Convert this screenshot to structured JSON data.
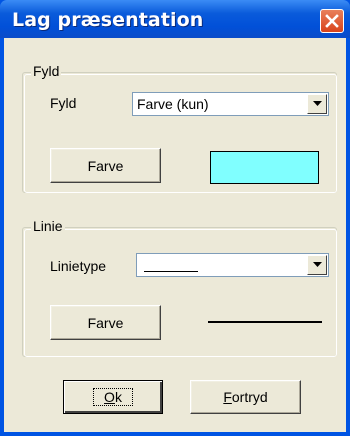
{
  "window": {
    "title": "Lag præsentation"
  },
  "icons": {
    "close": "close-x-icon",
    "dropdown": "chevron-down-icon"
  },
  "colors": {
    "fill_swatch": "#80ffff",
    "titlebar": "#0054e3",
    "close_button": "#d9431b"
  },
  "fill_group": {
    "legend": "Fyld",
    "fill_label": "Fyld",
    "fill_select": {
      "value": "Farve (kun)"
    },
    "color_button": "Farve"
  },
  "line_group": {
    "legend": "Linie",
    "linetype_label": "Linietype",
    "linetype_select": {
      "value": "solid-line"
    },
    "color_button": "Farve"
  },
  "buttons": {
    "ok_mnemonic": "O",
    "ok_rest": "k",
    "cancel_mnemonic": "F",
    "cancel_rest": "ortryd"
  }
}
